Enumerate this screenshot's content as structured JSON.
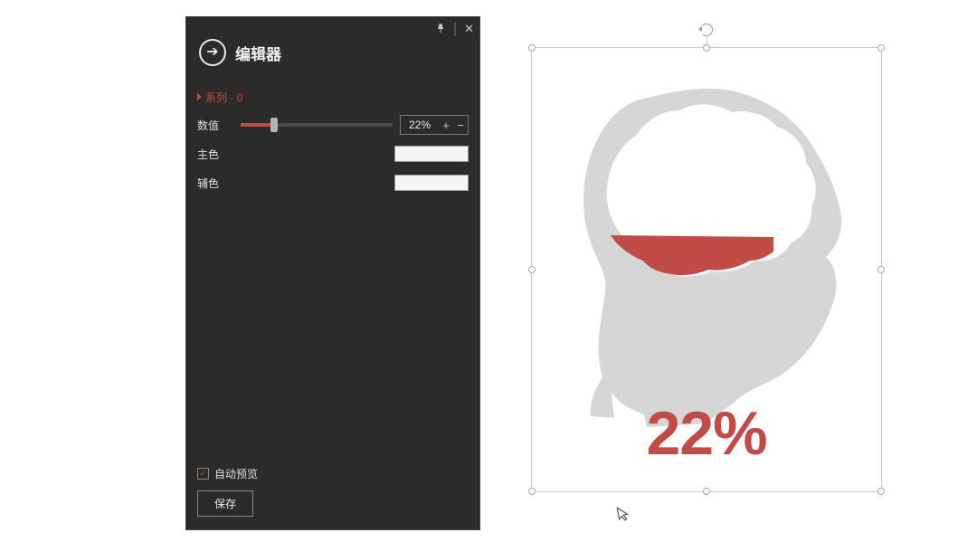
{
  "editor": {
    "title": "编辑器",
    "series_label": "系列 - 0",
    "value_label": "数值",
    "value_display": "22%",
    "main_color_label": "主色",
    "aux_color_label": "辅色",
    "auto_preview_label": "自动预览",
    "auto_preview_checked": true,
    "save_label": "保存",
    "colors": {
      "main": "#f5f5f5",
      "aux": "#f5f5f5"
    }
  },
  "chart_data": {
    "type": "pictograph-fill",
    "shape": "head-brain",
    "value_percent": 22,
    "value_label": "22%",
    "fill_color": "#c14b45",
    "container_color": "#d6d6d6",
    "inner_color": "#ffffff"
  }
}
